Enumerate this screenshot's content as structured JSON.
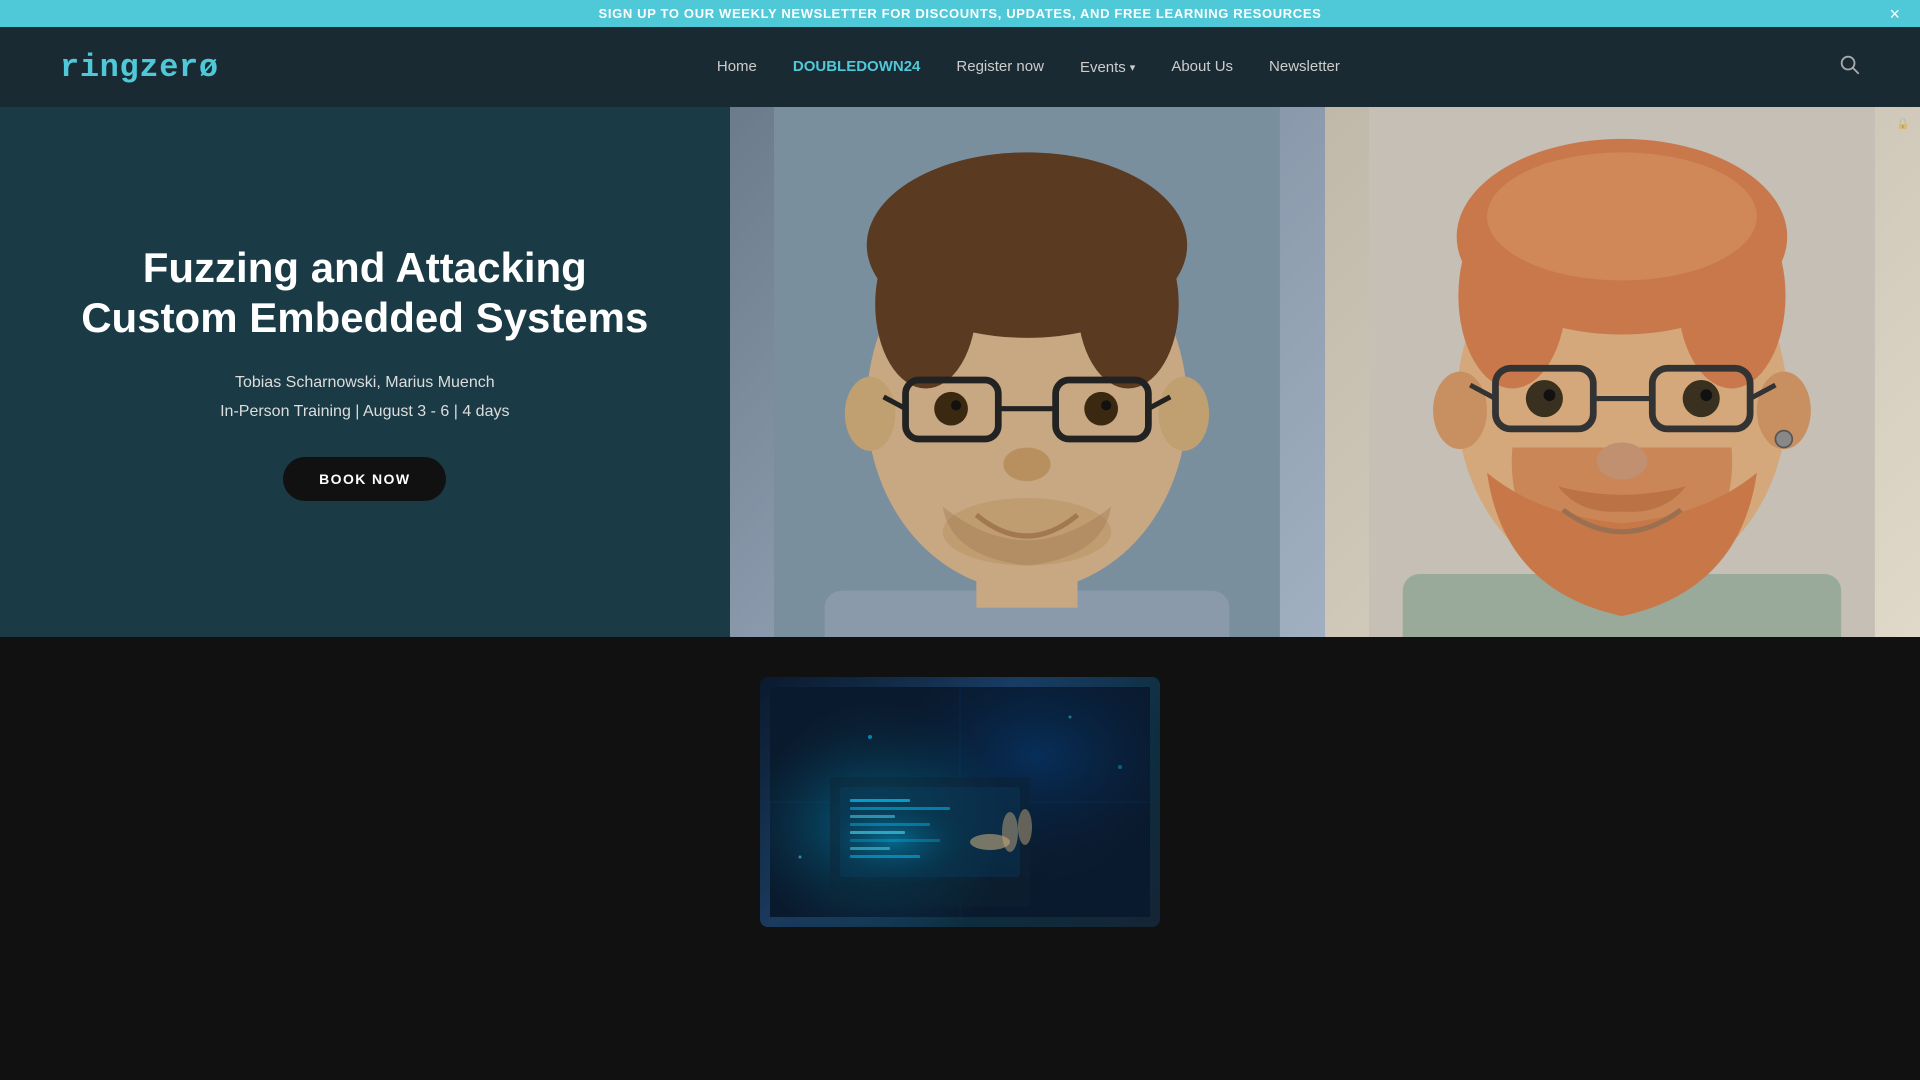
{
  "banner": {
    "text": "SIGN UP TO OUR WEEKLY NEWSLETTER FOR DISCOUNTS, UPDATES, AND FREE LEARNING RESOURCES",
    "close_label": "×"
  },
  "navbar": {
    "logo": "ringzerø",
    "nav_items": [
      {
        "label": "Home",
        "href": "#",
        "highlight": false,
        "active": true
      },
      {
        "label": "DOUBLEDOWN24",
        "href": "#",
        "highlight": true,
        "active": false
      },
      {
        "label": "Register now",
        "href": "#",
        "highlight": false,
        "active": false
      },
      {
        "label": "Events",
        "href": "#",
        "highlight": false,
        "active": false,
        "has_dropdown": true
      },
      {
        "label": "About Us",
        "href": "#",
        "highlight": false,
        "active": false
      },
      {
        "label": "Newsletter",
        "href": "#",
        "highlight": false,
        "active": false
      }
    ],
    "search_icon": "🔍"
  },
  "hero": {
    "title": "Fuzzing and Attacking Custom Embedded Systems",
    "subtitle": "Tobias Scharnowski, Marius Muench",
    "details": "In-Person Training | August 3 - 6 | 4 days",
    "cta_label": "BOOK NOW",
    "watermark": "🔒"
  },
  "preview": {
    "alt_text": "Cyber security background image with keyboard"
  }
}
